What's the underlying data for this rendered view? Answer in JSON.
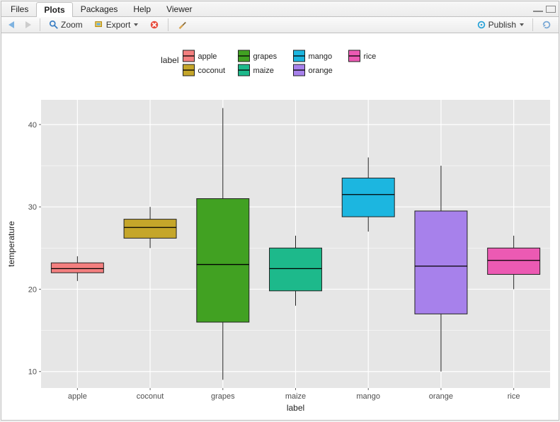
{
  "tabs": {
    "files": "Files",
    "plots": "Plots",
    "packages": "Packages",
    "help": "Help",
    "viewer": "Viewer"
  },
  "toolbar": {
    "zoom": "Zoom",
    "export": "Export",
    "publish": "Publish"
  },
  "chart_data": {
    "type": "boxplot",
    "xlabel": "label",
    "ylabel": "temperature",
    "ylim": [
      8,
      43
    ],
    "yticks": [
      10,
      20,
      30,
      40
    ],
    "categories": [
      "apple",
      "coconut",
      "grapes",
      "maize",
      "mango",
      "orange",
      "rice"
    ],
    "legend_title": "label",
    "series": [
      {
        "name": "apple",
        "color": "#f37f7f",
        "min": 21.0,
        "q1": 22.0,
        "median": 22.5,
        "q3": 23.2,
        "max": 24.0
      },
      {
        "name": "coconut",
        "color": "#c5a62a",
        "min": 25.0,
        "q1": 26.2,
        "median": 27.5,
        "q3": 28.5,
        "max": 30.0
      },
      {
        "name": "grapes",
        "color": "#41a122",
        "min": 9.0,
        "q1": 16.0,
        "median": 23.0,
        "q3": 31.0,
        "max": 42.0
      },
      {
        "name": "maize",
        "color": "#1db98b",
        "min": 18.0,
        "q1": 19.8,
        "median": 22.5,
        "q3": 25.0,
        "max": 26.5
      },
      {
        "name": "mango",
        "color": "#1cb6e0",
        "min": 27.0,
        "q1": 28.8,
        "median": 31.5,
        "q3": 33.5,
        "max": 36.0
      },
      {
        "name": "orange",
        "color": "#a781eb",
        "min": 10.0,
        "q1": 17.0,
        "median": 22.8,
        "q3": 29.5,
        "max": 35.0
      },
      {
        "name": "rice",
        "color": "#ec5ab3",
        "min": 20.0,
        "q1": 21.8,
        "median": 23.5,
        "q3": 25.0,
        "max": 26.5
      }
    ]
  }
}
